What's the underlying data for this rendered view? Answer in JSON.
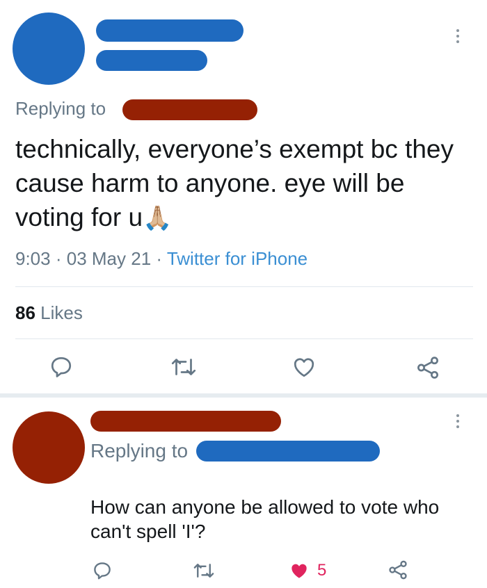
{
  "main_tweet": {
    "replying_label": "Replying to",
    "body": "technically, everyone’s exempt bc they cause harm to anyone. eye will be voting for u",
    "emoji": "🙏🏼",
    "time": "9:03",
    "sep1": "·",
    "date": "03 May 21",
    "sep2": "·",
    "source": "Twitter for iPhone",
    "likes_count": "86",
    "likes_label": "Likes"
  },
  "reply_tweet": {
    "replying_label": "Replying to",
    "body_line1": "How can anyone be allowed to vote who",
    "body_line2": "can't spell 'I'?",
    "like_count": "5"
  },
  "icons": [
    "more-icon",
    "reply-icon",
    "retweet-icon",
    "like-icon",
    "share-icon"
  ],
  "colors": {
    "redaction_blue": "#1f6abf",
    "redaction_red": "#952104",
    "link_blue": "#3b8fd3",
    "like_red": "#e0245e",
    "muted_gray": "#657786"
  }
}
